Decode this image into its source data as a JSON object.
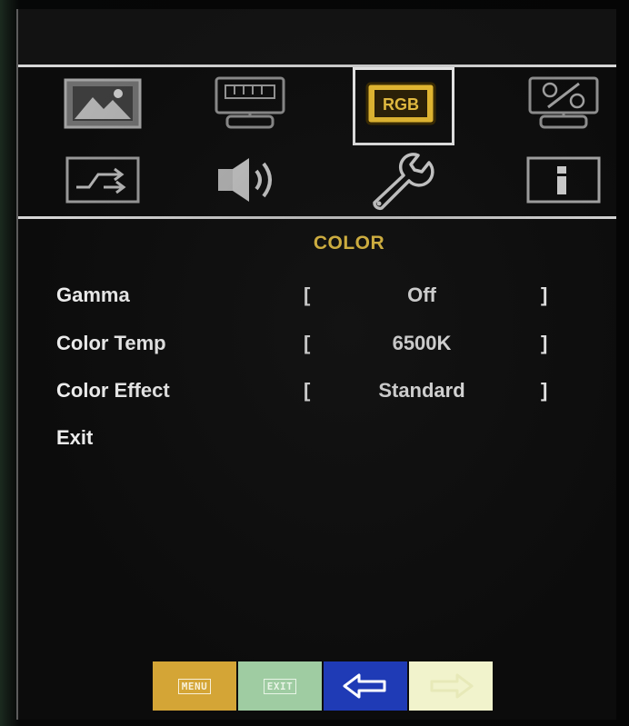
{
  "osd": {
    "icons": [
      {
        "name": "picture-icon",
        "selected": false
      },
      {
        "name": "monitor-adjust-icon",
        "selected": false
      },
      {
        "name": "rgb-color-icon",
        "label": "RGB",
        "selected": true
      },
      {
        "name": "display-percent-icon",
        "selected": false
      },
      {
        "name": "input-switch-icon",
        "selected": false
      },
      {
        "name": "audio-speaker-icon",
        "selected": false
      },
      {
        "name": "wrench-setup-icon",
        "selected": false
      },
      {
        "name": "info-icon",
        "selected": false
      }
    ],
    "title": "COLOR",
    "items": [
      {
        "label": "Gamma",
        "value": "Off",
        "bracket_open": "[",
        "bracket_close": "]"
      },
      {
        "label": "Color Temp",
        "value": "6500K",
        "bracket_open": "[",
        "bracket_close": "]"
      },
      {
        "label": "Color Effect",
        "value": "Standard",
        "bracket_open": "[",
        "bracket_close": "]"
      },
      {
        "label": "Exit"
      }
    ]
  },
  "keys": {
    "menu_label": "MENU",
    "exit_label": "EXIT"
  },
  "colors": {
    "title": "#f3cb45",
    "selected_icon_bg": "#f1c232",
    "text": "#f2f2f2",
    "background": "#0c0c0c",
    "menu_key": "#d4a536",
    "exit_key": "#9fcca2",
    "back_key": "#1f3bb6",
    "enter_key": "#f1f3cc"
  }
}
